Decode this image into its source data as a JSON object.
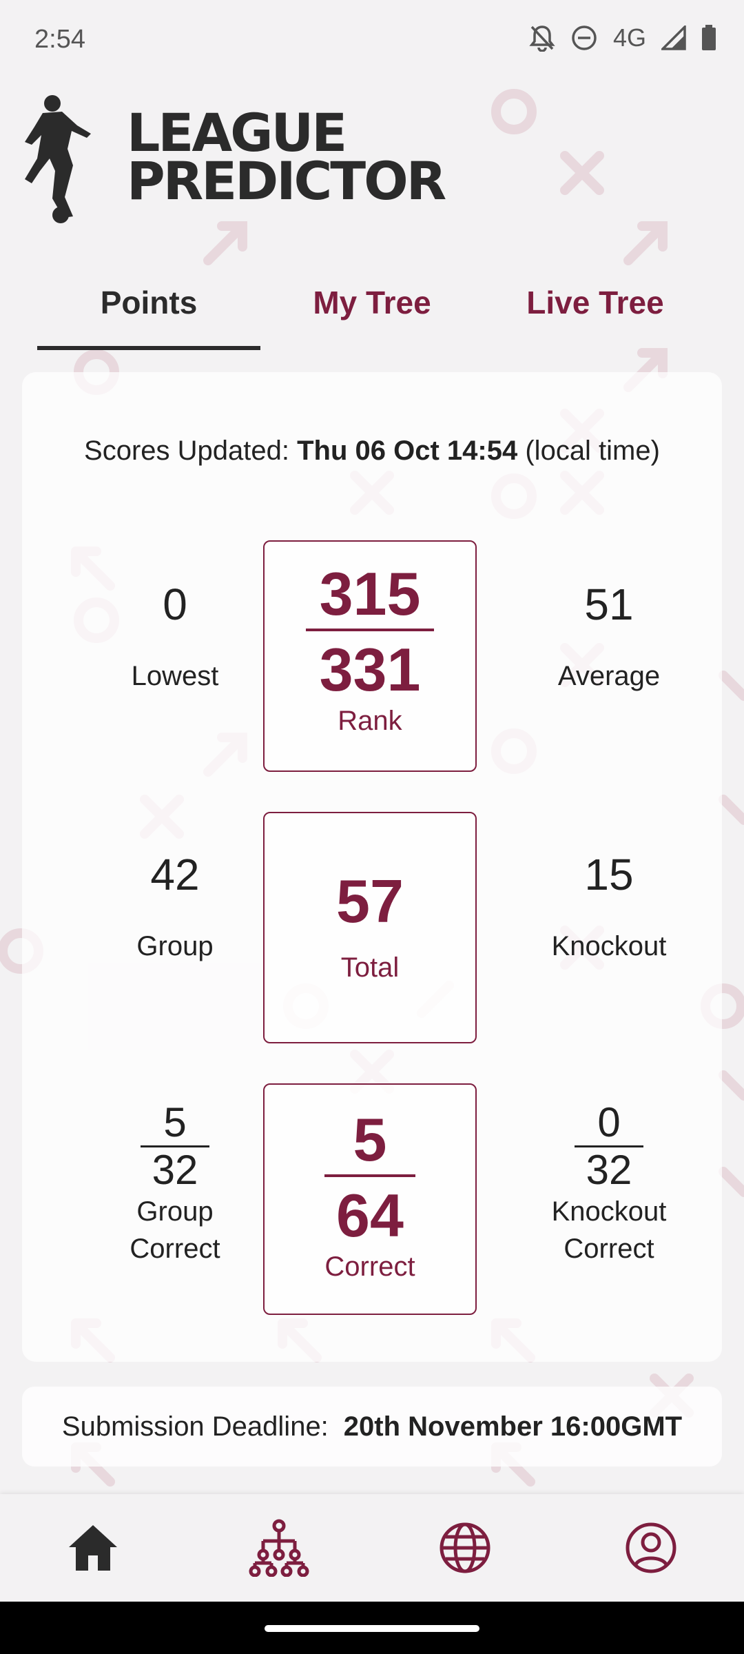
{
  "status": {
    "time": "2:54",
    "network": "4G"
  },
  "logo": {
    "line1": "LEAGUE",
    "line2": "PREDICTOR"
  },
  "tabs": [
    {
      "label": "Points",
      "active": true
    },
    {
      "label": "My Tree",
      "active": false
    },
    {
      "label": "Live Tree",
      "active": false
    }
  ],
  "scores": {
    "updated_label": "Scores Updated:",
    "updated_value": "Thu 06 Oct 14:54",
    "updated_suffix": "(local time)",
    "rows": {
      "rank_row": {
        "left": {
          "value": "0",
          "label": "Lowest"
        },
        "center": {
          "numerator": "315",
          "denominator": "331",
          "label": "Rank"
        },
        "right": {
          "value": "51",
          "label": "Average"
        }
      },
      "total_row": {
        "left": {
          "value": "42",
          "label": "Group"
        },
        "center": {
          "value": "57",
          "label": "Total"
        },
        "right": {
          "value": "15",
          "label": "Knockout"
        }
      },
      "correct_row": {
        "left": {
          "numerator": "5",
          "denominator": "32",
          "label_line1": "Group",
          "label_line2": "Correct"
        },
        "center": {
          "numerator": "5",
          "denominator": "64",
          "label": "Correct"
        },
        "right": {
          "numerator": "0",
          "denominator": "32",
          "label_line1": "Knockout",
          "label_line2": "Correct"
        }
      }
    }
  },
  "deadline": {
    "label": "Submission Deadline:",
    "value": "20th November 16:00GMT"
  },
  "nav": [
    "home-icon",
    "tree-icon",
    "globe-icon",
    "account-icon"
  ],
  "colors": {
    "accent": "#7d1e3f",
    "text": "#2b2b2b",
    "background": "#f3f2f3"
  }
}
